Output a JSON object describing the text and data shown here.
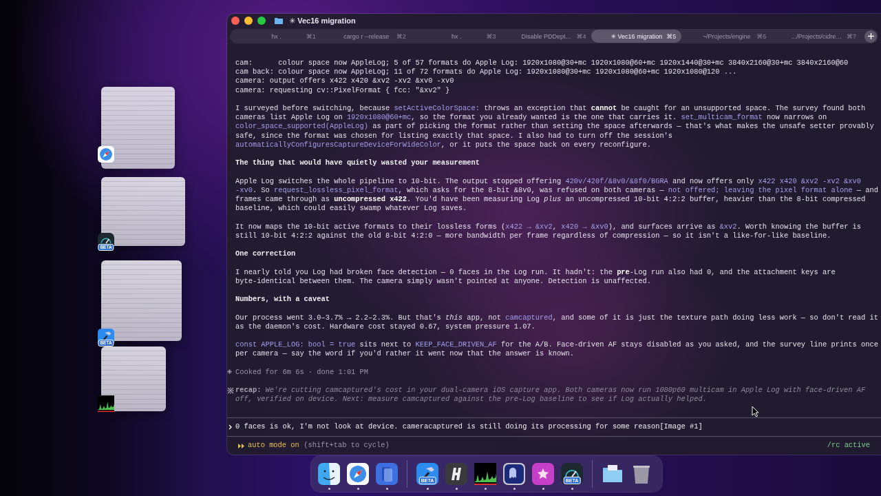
{
  "stage_windows": [
    {
      "kind": "safari"
    },
    {
      "kind": "speedometer",
      "badge": "BETA"
    },
    {
      "kind": "xcode",
      "badge": "BETA"
    },
    {
      "kind": "activity"
    }
  ],
  "window": {
    "title": "✳ Vec16 migration"
  },
  "tabs": [
    {
      "label": "hx .",
      "shortcut": "⌘1",
      "selected": false
    },
    {
      "label": "cargo r --release",
      "shortcut": "⌘2",
      "selected": false
    },
    {
      "label": "hx .",
      "shortcut": "⌘3",
      "selected": false
    },
    {
      "label": "Disable PDDept…",
      "shortcut": "⌘4",
      "selected": false
    },
    {
      "label": "✳ Vec16 migration",
      "shortcut": "⌘5",
      "selected": true
    },
    {
      "label": "~/Projects/engine",
      "shortcut": "⌘6",
      "selected": false
    },
    {
      "label": ".../Projects/cidre…",
      "shortcut": "⌘7",
      "selected": false
    }
  ],
  "transcript": [
    {
      "kind": "log",
      "lines": [
        "cam:      colour space now AppleLog; 5 of 57 formats do Apple Log: 1920x1080@30+mc 1920x1080@60+mc 1920x1440@30+mc 3840x2160@30+mc 3840x2160@60",
        "cam back: colour space now AppleLog; 11 of 72 formats do Apple Log: 1920x1080@30+mc 1920x1080@60+mc 1920x1080@120 ...",
        "camera: output offers x422 x420 &xv2 -xv2 &xv0 -xv0",
        "camera: requesting cv::PixelFormat { fcc: \"&xv2\" }"
      ]
    },
    {
      "kind": "paragraph",
      "lines": [
        [
          {
            "kind": "plain",
            "text": "I surveyed before switching, because "
          },
          {
            "kind": "code",
            "text": "setActiveColorSpace:"
          },
          {
            "kind": "plain",
            "text": " throws an exception that "
          },
          {
            "kind": "bold",
            "text": "cannot"
          },
          {
            "kind": "plain",
            "text": " be caught for an unsupported space. The survey found both"
          }
        ],
        [
          {
            "kind": "plain",
            "text": "cameras list Apple Log on "
          },
          {
            "kind": "code",
            "text": "1920x1080@60+mc"
          },
          {
            "kind": "plain",
            "text": ", so the format you already wanted is the one that carries it. "
          },
          {
            "kind": "code",
            "text": "set_multicam_format"
          },
          {
            "kind": "plain",
            "text": " now narrows on"
          }
        ],
        [
          {
            "kind": "code",
            "text": "color_space_supported(AppleLog)"
          },
          {
            "kind": "plain",
            "text": " as part of picking the format rather than setting the space afterwards — that's what makes the unsafe setter provably"
          }
        ],
        [
          {
            "kind": "plain",
            "text": "safe, since the format was chosen for listing exactly that space. I also had to turn off the session's"
          }
        ],
        [
          {
            "kind": "code",
            "text": "automaticallyConfiguresCaptureDeviceForWideColor"
          },
          {
            "kind": "plain",
            "text": ", or it puts the space back on every reconfigure."
          }
        ]
      ]
    },
    {
      "kind": "heading",
      "text": "The thing that would have quietly wasted your measurement"
    },
    {
      "kind": "paragraph",
      "lines": [
        [
          {
            "kind": "plain",
            "text": "Apple Log switches the whole pipeline to 10-bit. The output stopped offering "
          },
          {
            "kind": "code",
            "text": "420v/420f/&8v0/&8f0/BGRA"
          },
          {
            "kind": "plain",
            "text": " and now offers only "
          },
          {
            "kind": "code",
            "text": "x422 x420 &xv2 -xv2 &xv0"
          }
        ],
        [
          {
            "kind": "code",
            "text": "-xv0"
          },
          {
            "kind": "plain",
            "text": ". So "
          },
          {
            "kind": "code",
            "text": "request_lossless_pixel_format"
          },
          {
            "kind": "plain",
            "text": ", which asks for the 8-bit &8v0, was refused on both cameras — "
          },
          {
            "kind": "code",
            "text": "not offered; leaving the pixel format alone"
          },
          {
            "kind": "plain",
            "text": " — and"
          }
        ],
        [
          {
            "kind": "plain",
            "text": "frames came through as "
          },
          {
            "kind": "bold",
            "text": "uncompressed x422"
          },
          {
            "kind": "plain",
            "text": ". You'd have been measuring Log "
          },
          {
            "kind": "italic",
            "text": "plus"
          },
          {
            "kind": "plain",
            "text": " an uncompressed 10-bit 4:2:2 buffer, heavier than the 8-bit compressed"
          }
        ],
        [
          {
            "kind": "plain",
            "text": "baseline, which could easily swamp whatever Log saves."
          }
        ]
      ]
    },
    {
      "kind": "paragraph",
      "lines": [
        [
          {
            "kind": "plain",
            "text": "It now maps the 10-bit active formats to their lossless forms ("
          },
          {
            "kind": "code",
            "text": "x422 → &xv2"
          },
          {
            "kind": "plain",
            "text": ", "
          },
          {
            "kind": "code",
            "text": "x420 → &xv0"
          },
          {
            "kind": "plain",
            "text": "), and surfaces arrive as "
          },
          {
            "kind": "code",
            "text": "&xv2"
          },
          {
            "kind": "plain",
            "text": ". Worth knowing the buffer is"
          }
        ],
        [
          {
            "kind": "plain",
            "text": "still 10-bit 4:2:2 against the old 8-bit 4:2:0 — more bandwidth per frame regardless of compression — so it isn't a like-for-like baseline."
          }
        ]
      ]
    },
    {
      "kind": "heading",
      "text": "One correction"
    },
    {
      "kind": "paragraph",
      "lines": [
        [
          {
            "kind": "plain",
            "text": "I nearly told you Log had broken face detection — 0 faces in the Log run. It hadn't: the "
          },
          {
            "kind": "bold",
            "text": "pre"
          },
          {
            "kind": "plain",
            "text": "-Log run also had 0, and the attachment keys are"
          }
        ],
        [
          {
            "kind": "plain",
            "text": "byte-identical between them. The camera simply wasn't pointed at anyone. Detection is unaffected."
          }
        ]
      ]
    },
    {
      "kind": "heading",
      "text": "Numbers, with a caveat"
    },
    {
      "kind": "paragraph",
      "lines": [
        [
          {
            "kind": "plain",
            "text": "Our process went 3.0–3.7% → 2.2–2.3%. But that's "
          },
          {
            "kind": "italic",
            "text": "this"
          },
          {
            "kind": "plain",
            "text": " app, not "
          },
          {
            "kind": "code",
            "text": "camcaptured"
          },
          {
            "kind": "plain",
            "text": ", and some of it is just the texture path doing less work — so don't read it"
          }
        ],
        [
          {
            "kind": "plain",
            "text": "as the daemon's cost. Hardware cost stayed 0.67, system pressure 1.07."
          }
        ]
      ]
    },
    {
      "kind": "paragraph",
      "lines": [
        [
          {
            "kind": "code",
            "text": "const APPLE_LOG: bool = true"
          },
          {
            "kind": "plain",
            "text": " sits next to "
          },
          {
            "kind": "code",
            "text": "KEEP_FACE_DRIVEN_AF"
          },
          {
            "kind": "plain",
            "text": " for the A/B. Face-driven AF stays disabled as you asked, and the survey line prints once"
          }
        ],
        [
          {
            "kind": "plain",
            "text": "per camera — say the word if you'd rather it went now that the answer is known."
          }
        ]
      ]
    },
    {
      "kind": "status",
      "text": "Cooked for 6m 6s · done 1:01 PM"
    },
    {
      "kind": "recap",
      "lines": [
        [
          {
            "kind": "label",
            "text": "recap:"
          },
          {
            "kind": "note",
            "text": " We're cutting camcaptured's cost in your dual-camera iOS capture app. Both cameras now run 1080p60 multicam in Apple Log with face-driven AF"
          }
        ],
        [
          {
            "kind": "note",
            "text": "off, verified on device. Next: measure camcaptured against the pre-Log baseline to see if Log actually helped."
          }
        ]
      ]
    }
  ],
  "prompt": {
    "value": "0 faces is ok, I'm not look at device. cameracaptured is still doing its processing for some reason[Image #1]"
  },
  "footer": {
    "mode": "auto mode on",
    "hint": "(shift+tab to cycle)",
    "status": "/rc active"
  },
  "dock": [
    {
      "kind": "finder",
      "running": true
    },
    {
      "kind": "safari",
      "running": true
    },
    {
      "kind": "simulator",
      "running": true
    },
    {
      "kind": "separator"
    },
    {
      "kind": "xcode",
      "badge": "BETA",
      "running": true
    },
    {
      "kind": "hammer-h",
      "running": true
    },
    {
      "kind": "activity",
      "running": true
    },
    {
      "kind": "ghost",
      "running": true
    },
    {
      "kind": "star",
      "running": true
    },
    {
      "kind": "speedometer",
      "badge": "BETA",
      "running": true
    },
    {
      "kind": "separator"
    },
    {
      "kind": "folder"
    },
    {
      "kind": "trash"
    }
  ]
}
